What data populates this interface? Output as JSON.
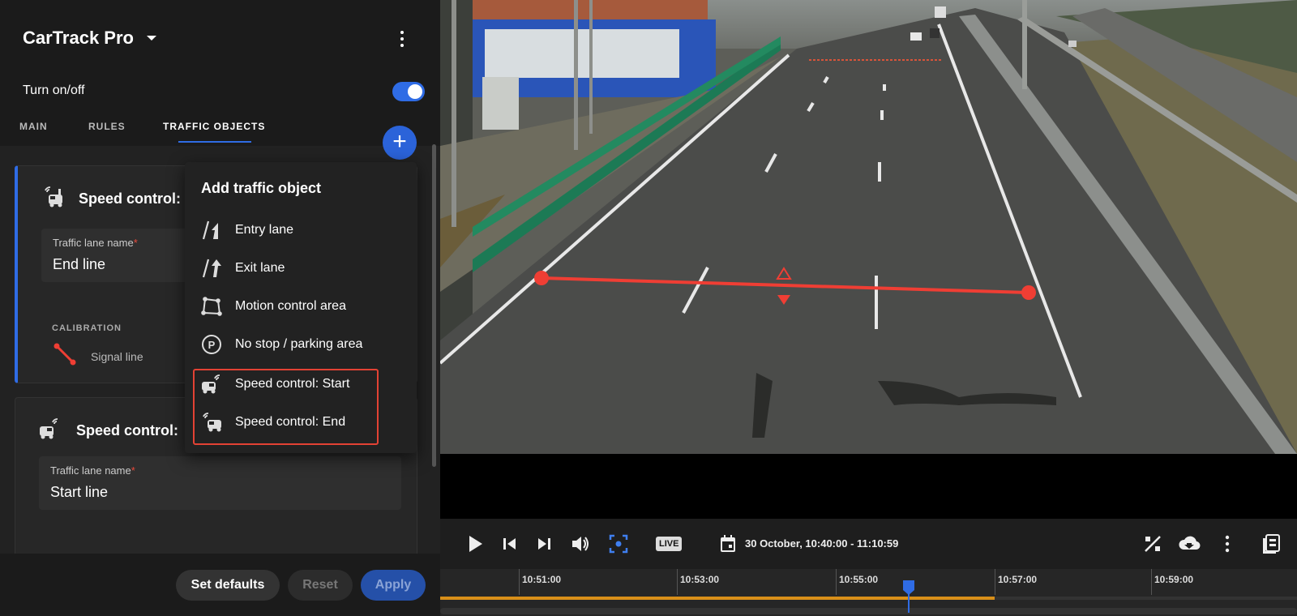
{
  "app": {
    "title": "CarTrack Pro"
  },
  "toggle": {
    "label": "Turn on/off",
    "on": true
  },
  "tabs": {
    "main": "MAIN",
    "rules": "RULES",
    "traffic": "TRAFFIC OBJECTS",
    "active": "TRAFFIC OBJECTS"
  },
  "cards": {
    "end": {
      "title": "Speed control:",
      "field_label": "Traffic lane name",
      "required_mark": "*",
      "field_value": "End line",
      "calibration_label": "CALIBRATION",
      "signal_line_label": "Signal line"
    },
    "start": {
      "title": "Speed control:",
      "field_label": "Traffic lane name",
      "required_mark": "*",
      "field_value": "Start line"
    }
  },
  "menu": {
    "title": "Add traffic object",
    "items": [
      {
        "label": "Entry lane",
        "icon": "entry-lane-icon"
      },
      {
        "label": "Exit lane",
        "icon": "exit-lane-icon"
      },
      {
        "label": "Motion control area",
        "icon": "motion-area-icon"
      },
      {
        "label": "No stop / parking area",
        "icon": "parking-icon"
      },
      {
        "label": "Speed control: Start",
        "icon": "speed-start-icon"
      },
      {
        "label": "Speed control: End",
        "icon": "speed-end-icon"
      }
    ]
  },
  "footer": {
    "set_defaults": "Set defaults",
    "reset": "Reset",
    "apply": "Apply"
  },
  "player": {
    "live": "LIVE",
    "range": "30 October, 10:40:00 - 11:10:59",
    "ticks": [
      "10:51:00",
      "10:53:00",
      "10:55:00",
      "10:57:00",
      "10:59:00"
    ]
  },
  "colors": {
    "accent": "#2f6ce5",
    "highlight": "#e34234",
    "signal_line": "#ef3e34",
    "timeline": "#d88f19"
  }
}
